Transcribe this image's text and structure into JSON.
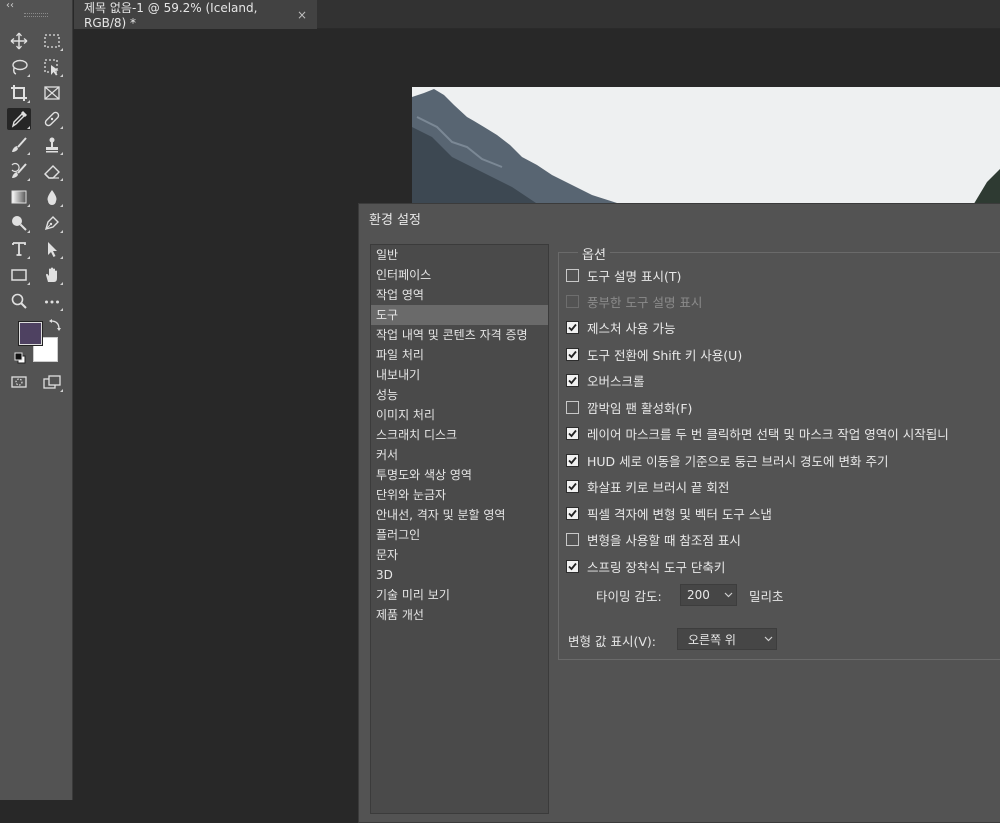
{
  "document_tab": {
    "title": "제목 없음-1 @ 59.2% (Iceland, RGB/8) *",
    "close_glyph": "×"
  },
  "toolbar": {
    "collapse_glyph": "‹‹",
    "tools": [
      {
        "name": "move-tool-icon"
      },
      {
        "name": "marquee-tool-icon"
      },
      {
        "name": "lasso-tool-icon"
      },
      {
        "name": "object-select-tool-icon"
      },
      {
        "name": "crop-tool-icon"
      },
      {
        "name": "frame-tool-icon"
      },
      {
        "name": "eyedropper-tool-icon",
        "active": true
      },
      {
        "name": "healing-brush-tool-icon"
      },
      {
        "name": "brush-tool-icon"
      },
      {
        "name": "clone-stamp-tool-icon"
      },
      {
        "name": "history-brush-tool-icon"
      },
      {
        "name": "eraser-tool-icon"
      },
      {
        "name": "gradient-tool-icon"
      },
      {
        "name": "blur-tool-icon"
      },
      {
        "name": "dodge-tool-icon"
      },
      {
        "name": "pen-tool-icon"
      },
      {
        "name": "type-tool-icon"
      },
      {
        "name": "path-select-tool-icon"
      },
      {
        "name": "rectangle-tool-icon"
      },
      {
        "name": "hand-tool-icon"
      },
      {
        "name": "zoom-tool-icon"
      },
      {
        "name": "more-tools-icon"
      },
      {
        "name": "quick-mask-icon"
      },
      {
        "name": "screen-mode-icon"
      }
    ],
    "foreground_color": "#4e4161",
    "background_color": "#ffffff"
  },
  "dialog": {
    "title": "환경 설정",
    "categories": [
      {
        "label": "일반"
      },
      {
        "label": "인터페이스"
      },
      {
        "label": "작업 영역"
      },
      {
        "label": "도구",
        "selected": true
      },
      {
        "label": "작업 내역 및 콘텐츠 자격 증명"
      },
      {
        "label": "파일 처리"
      },
      {
        "label": "내보내기"
      },
      {
        "label": "성능"
      },
      {
        "label": "이미지 처리"
      },
      {
        "label": "스크래치 디스크"
      },
      {
        "label": "커서"
      },
      {
        "label": "투명도와 색상 영역"
      },
      {
        "label": "단위와 눈금자"
      },
      {
        "label": "안내선, 격자 및 분할 영역"
      },
      {
        "label": "플러그인"
      },
      {
        "label": "문자"
      },
      {
        "label": "3D"
      },
      {
        "label": "기술 미리 보기"
      },
      {
        "label": "제품 개선"
      }
    ],
    "options": {
      "legend": "옵션",
      "items": [
        {
          "label": "도구 설명 표시(T)",
          "checked": false,
          "enabled": true
        },
        {
          "label": "풍부한 도구 설명 표시",
          "checked": false,
          "enabled": false
        },
        {
          "label": "제스처 사용 가능",
          "checked": true,
          "enabled": true
        },
        {
          "label": "도구 전환에 Shift 키 사용(U)",
          "checked": true,
          "enabled": true
        },
        {
          "label": "오버스크롤",
          "checked": true,
          "enabled": true
        },
        {
          "label": "깜박임 팬 활성화(F)",
          "checked": false,
          "enabled": true
        },
        {
          "label": "레이어 마스크를 두 번 클릭하면 선택 및 마스크 작업 영역이 시작됩니",
          "checked": true,
          "enabled": true
        },
        {
          "label": "HUD 세로 이동을 기준으로 둥근 브러시 경도에 변화 주기",
          "checked": true,
          "enabled": true
        },
        {
          "label": "화살표 키로 브러시 끝 회전",
          "checked": true,
          "enabled": true
        },
        {
          "label": "픽셀 격자에 변형 및 벡터 도구 스냅",
          "checked": true,
          "enabled": true
        },
        {
          "label": "변형을 사용할 때 참조점 표시",
          "checked": false,
          "enabled": true
        },
        {
          "label": "스프링 장착식 도구 단축키",
          "checked": true,
          "enabled": true
        }
      ],
      "timing": {
        "label": "타이밍 감도:",
        "value": "200",
        "unit": "밀리초"
      },
      "transform_values": {
        "label": "변형 값 표시(V):",
        "value": "오른쪽 위"
      }
    }
  }
}
